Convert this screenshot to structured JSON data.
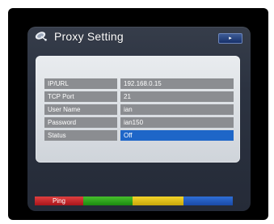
{
  "window": {
    "title": "Proxy Setting",
    "nav_button_glyph": "▸",
    "title_icon": "satellite-dish-icon"
  },
  "settings": {
    "rows": [
      {
        "label": "IP/URL",
        "value": "192.168.0.15",
        "selected": false
      },
      {
        "label": "TCP Port",
        "value": "21",
        "selected": false
      },
      {
        "label": "User Name",
        "value": "ian",
        "selected": false
      },
      {
        "label": "Password",
        "value": "ian150",
        "selected": false
      },
      {
        "label": "Status",
        "value": "Off",
        "selected": true
      }
    ]
  },
  "colorbar": {
    "red_label": "Ping",
    "green_label": "",
    "yellow_label": "",
    "blue_label": ""
  },
  "colors": {
    "selected_value_bg": "#1e66c8",
    "row_bg": "#8b8d91",
    "red_key": "#d12a2b",
    "green_key": "#2ea31c",
    "yellow_key": "#e6c014",
    "blue_key": "#245dc4"
  }
}
